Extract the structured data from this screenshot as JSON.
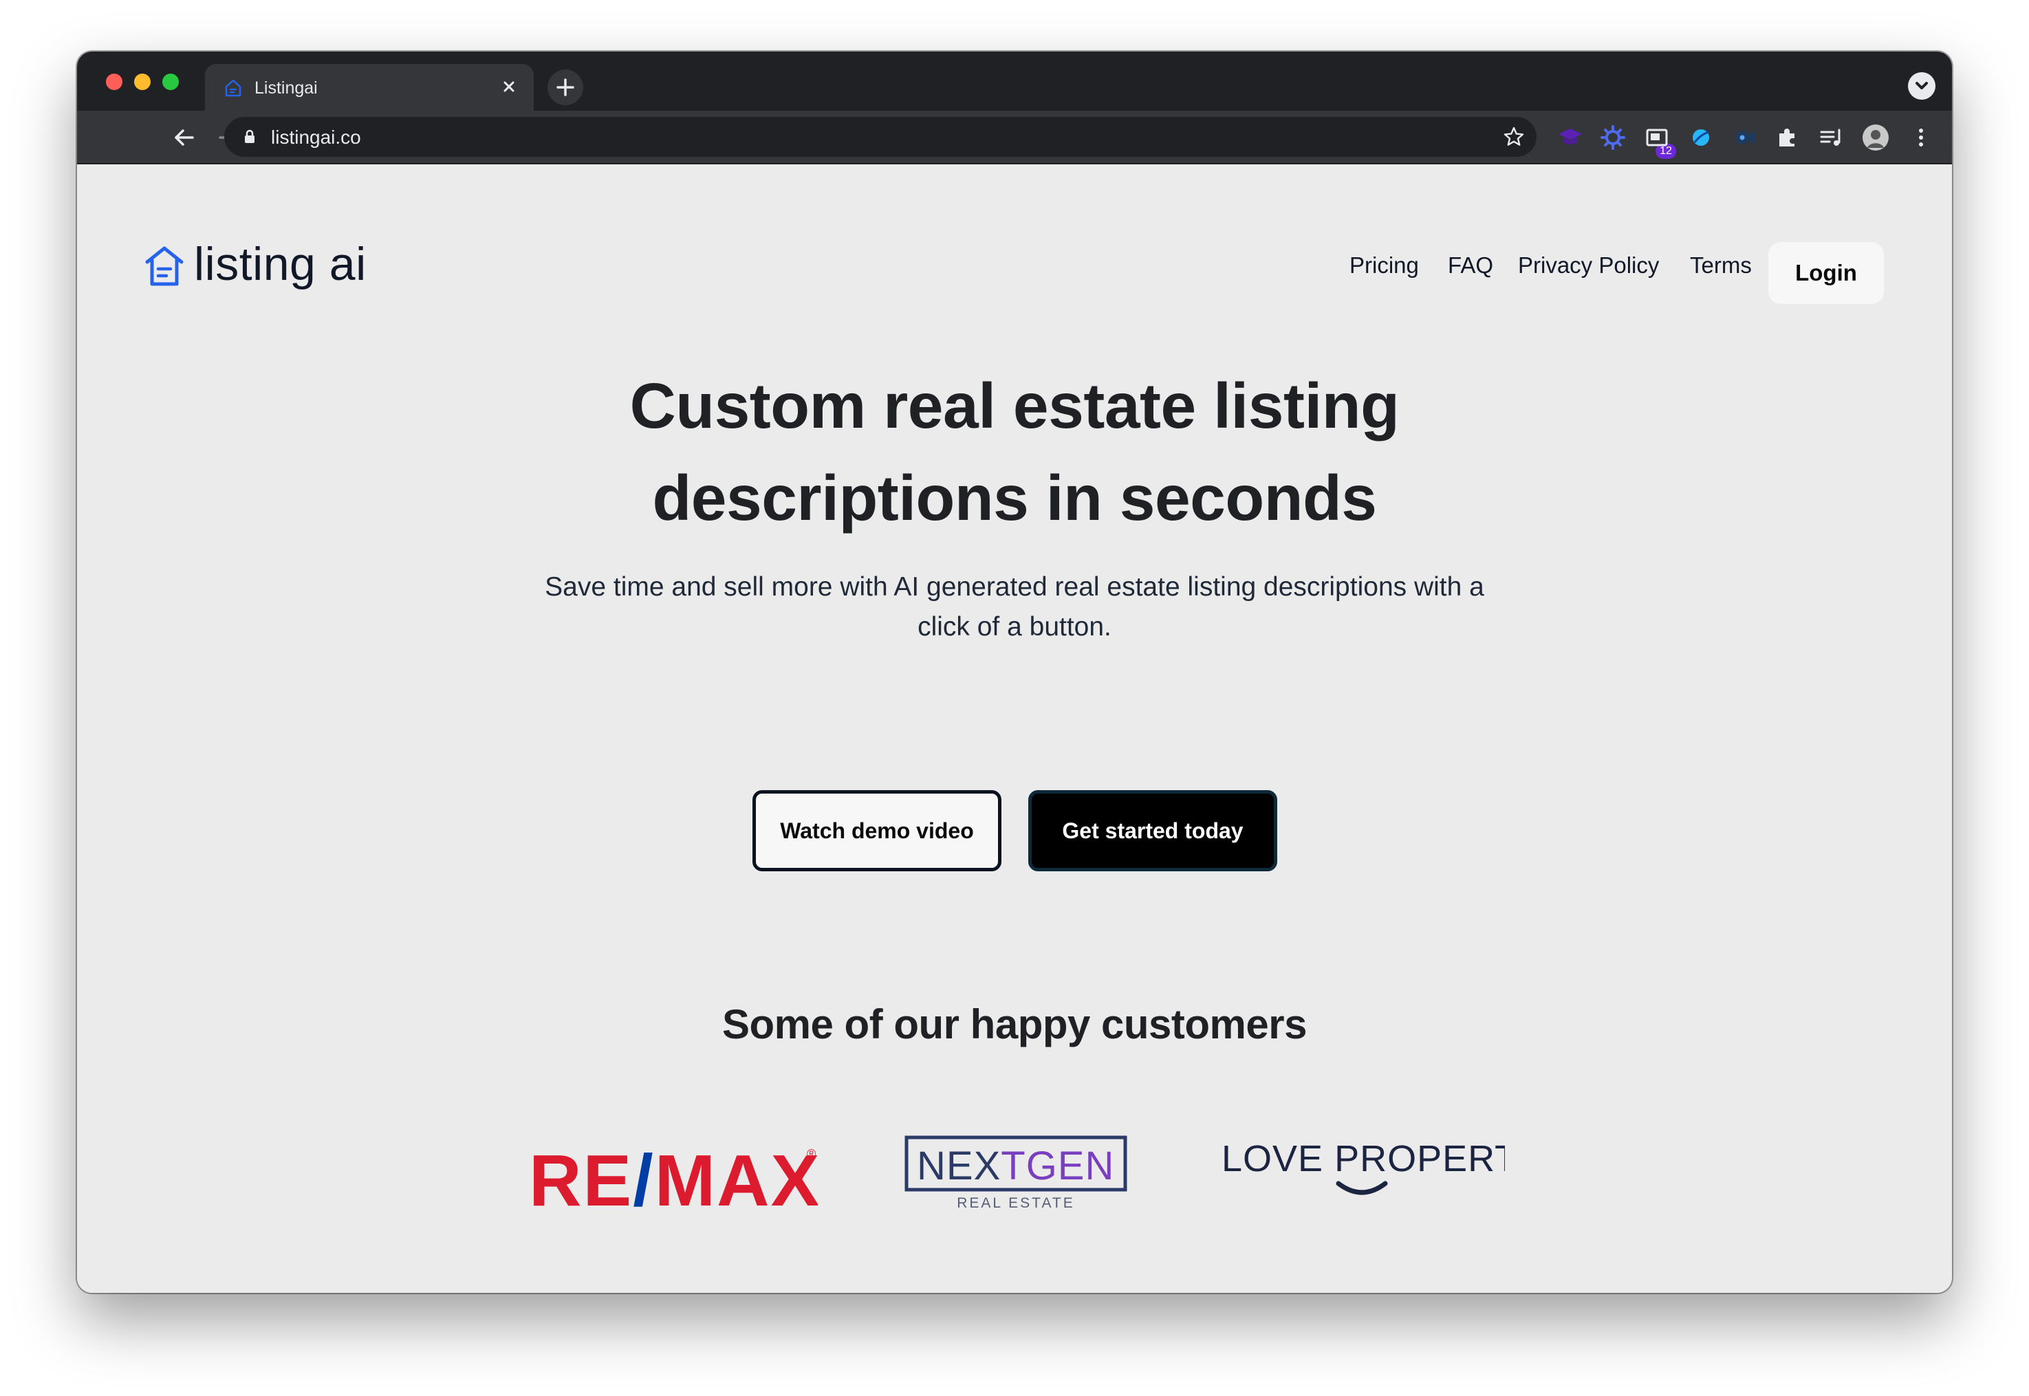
{
  "browser": {
    "tab_title": "Listingai",
    "url": "listingai.co",
    "extension_badge": "12"
  },
  "brand": {
    "name": "listing ai",
    "accent_color": "#2563eb"
  },
  "nav": {
    "items": [
      "Pricing",
      "FAQ",
      "Privacy Policy",
      "Terms"
    ],
    "login_label": "Login"
  },
  "hero": {
    "title_line1": "Custom real estate listing",
    "title_line2": "descriptions in seconds",
    "subtitle_line1": "Save time and sell more with AI generated real estate listing descriptions with a",
    "subtitle_line2": "click of a button.",
    "demo_button": "Watch demo video",
    "cta_button": "Get started today"
  },
  "customers": {
    "title": "Some of our happy customers",
    "logos": [
      {
        "name": "RE/MAX",
        "parts": [
          "RE",
          "/",
          "MAX"
        ],
        "mark": "®",
        "colors": [
          "#dc1c2e",
          "#003da5"
        ]
      },
      {
        "name": "NEXTGEN",
        "parts": [
          "NE",
          "X",
          "TGEN"
        ],
        "tagline": "REAL ESTATE",
        "colors": [
          "#2b3a67",
          "#7a3fbf"
        ]
      },
      {
        "name": "LOVE PROPERTY",
        "colors": [
          "#1b2440"
        ]
      }
    ]
  }
}
